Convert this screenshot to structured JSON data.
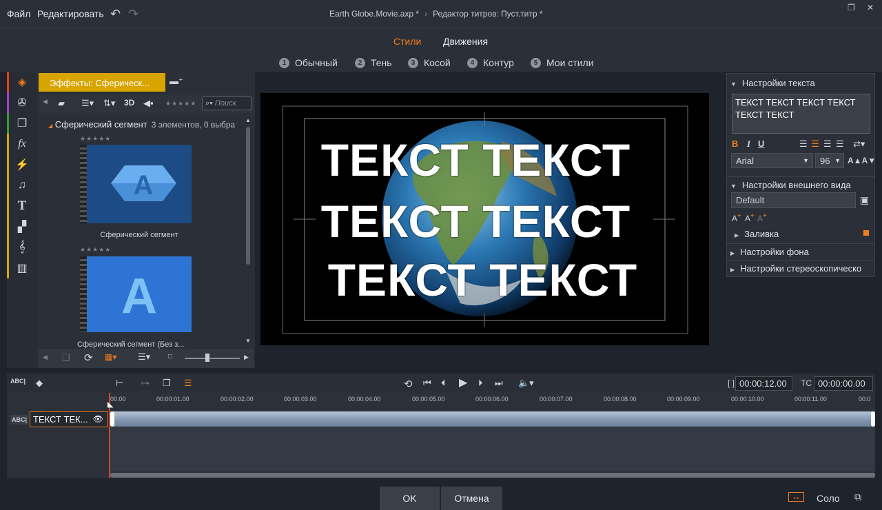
{
  "menu": {
    "file": "Файл",
    "edit": "Редактировать"
  },
  "breadcrumb": {
    "project": "Earth Globe.Movie.axp *",
    "editor": "Редактор титров: Пуст.титр *"
  },
  "main_tabs": {
    "styles": "Стили",
    "motions": "Движения"
  },
  "sub_tabs": [
    {
      "num": "1",
      "label": "Обычный"
    },
    {
      "num": "2",
      "label": "Тень"
    },
    {
      "num": "3",
      "label": "Косой"
    },
    {
      "num": "4",
      "label": "Контур"
    },
    {
      "num": "5",
      "label": "Мои стили"
    }
  ],
  "effects": {
    "tab_label": "Эффекты: Сферическ...",
    "search_placeholder": "Поиск",
    "three_d": "3D",
    "group_title": "Сферический сегмент",
    "group_count": "3 элементов, 0 выбра",
    "items": [
      {
        "label": "Сферический сегмент",
        "stars": "★★★★★"
      },
      {
        "label": "Сферический сегмент (Без з...",
        "stars": "★★★★★"
      }
    ]
  },
  "preview": {
    "lines": [
      "ТЕКСТ ТЕКСТ",
      "ТЕКСТ ТЕКСТ",
      "ТЕКСТ ТЕКСТ"
    ]
  },
  "text_settings": {
    "header": "Настройки текста",
    "content": "ТЕКСТ ТЕКСТ ТЕКСТ ТЕКСТ ТЕКСТ ТЕКСТ",
    "bold": "B",
    "italic": "I",
    "underline": "U",
    "font": "Arial",
    "size": "96"
  },
  "appearance": {
    "header": "Настройки внешнего вида",
    "preset": "Default",
    "fill": "Заливка"
  },
  "background_settings": "Настройки фона",
  "stereo_settings": "Настройки стереоскопическо",
  "timeline": {
    "duration": "00:00:12.00",
    "tc_label": "TC",
    "tc_value": "00:00:00.00",
    "ticks": [
      "00.00",
      "00:00:01.00",
      "00:00:02.00",
      "00:00:03.00",
      "00:00:04.00",
      "00:00:05.00",
      "00:00:06.00",
      "00:00:07.00",
      "00:00:08.00",
      "00:00:09.00",
      "00:00:10.00",
      "00:00:11.00",
      "00:0"
    ],
    "track_label": "ТЕКСТ ТЕК..."
  },
  "buttons": {
    "ok": "OK",
    "cancel": "Отмена",
    "solo": "Соло"
  },
  "colors": {
    "accent": "#f07d1e",
    "fx_tab": "#d7a400"
  }
}
